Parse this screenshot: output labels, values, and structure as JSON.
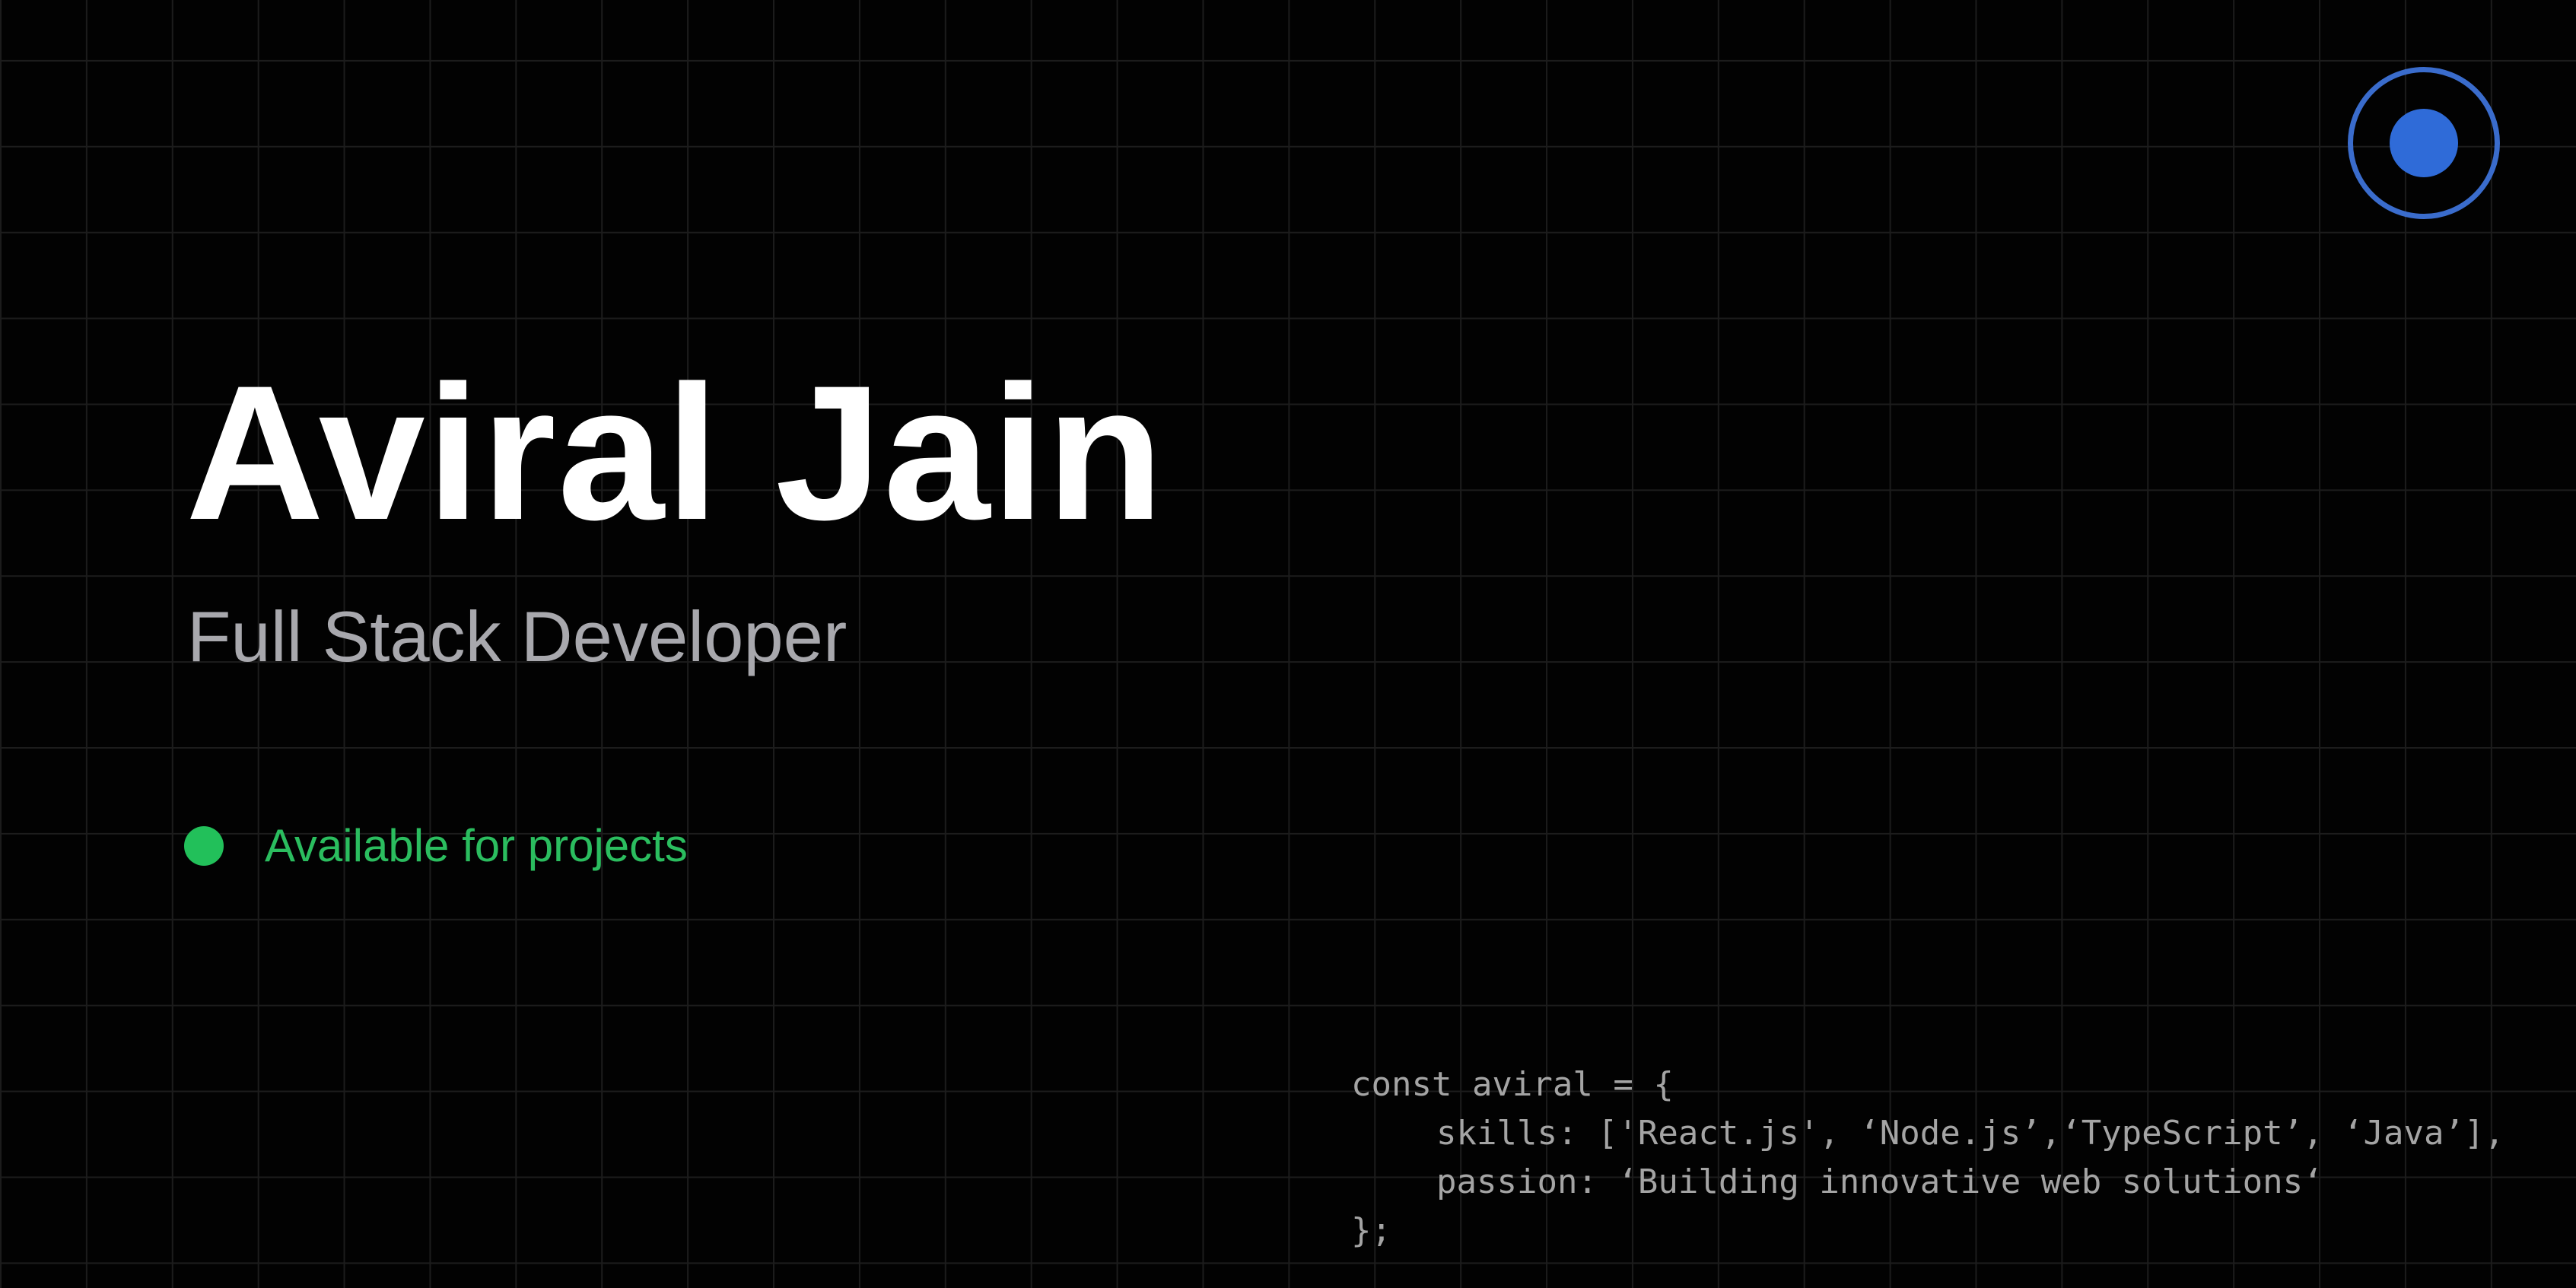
{
  "profile": {
    "name": "Aviral Jain",
    "role": "Full Stack Developer"
  },
  "status": {
    "label": "Available for projects",
    "color": "#22c05a"
  },
  "indicator": {
    "icon": "record-indicator-icon",
    "color": "#3a6ccc"
  },
  "code_snippet": {
    "lines": [
      "const aviral = {",
      "skills: ['React.js', ‘Node.js’,‘TypeScript’, ‘Java’],",
      "passion: ‘Building innovative web solutions‘",
      "};"
    ]
  }
}
